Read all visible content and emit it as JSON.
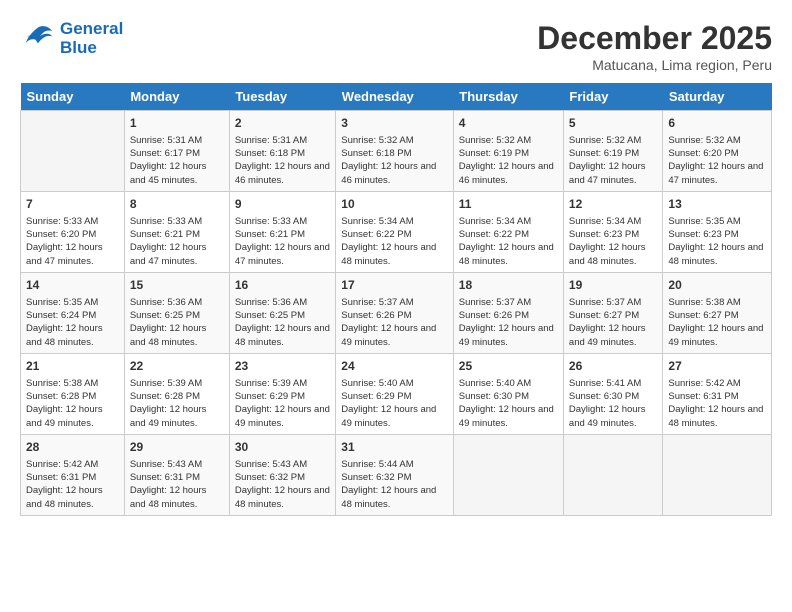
{
  "logo": {
    "line1": "General",
    "line2": "Blue"
  },
  "title": "December 2025",
  "subtitle": "Matucana, Lima region, Peru",
  "days_of_week": [
    "Sunday",
    "Monday",
    "Tuesday",
    "Wednesday",
    "Thursday",
    "Friday",
    "Saturday"
  ],
  "weeks": [
    [
      {
        "day": "",
        "empty": true
      },
      {
        "day": "1",
        "sunrise": "5:31 AM",
        "sunset": "6:17 PM",
        "daylight": "12 hours and 45 minutes."
      },
      {
        "day": "2",
        "sunrise": "5:31 AM",
        "sunset": "6:18 PM",
        "daylight": "12 hours and 46 minutes."
      },
      {
        "day": "3",
        "sunrise": "5:32 AM",
        "sunset": "6:18 PM",
        "daylight": "12 hours and 46 minutes."
      },
      {
        "day": "4",
        "sunrise": "5:32 AM",
        "sunset": "6:19 PM",
        "daylight": "12 hours and 46 minutes."
      },
      {
        "day": "5",
        "sunrise": "5:32 AM",
        "sunset": "6:19 PM",
        "daylight": "12 hours and 47 minutes."
      },
      {
        "day": "6",
        "sunrise": "5:32 AM",
        "sunset": "6:20 PM",
        "daylight": "12 hours and 47 minutes."
      }
    ],
    [
      {
        "day": "7",
        "sunrise": "5:33 AM",
        "sunset": "6:20 PM",
        "daylight": "12 hours and 47 minutes."
      },
      {
        "day": "8",
        "sunrise": "5:33 AM",
        "sunset": "6:21 PM",
        "daylight": "12 hours and 47 minutes."
      },
      {
        "day": "9",
        "sunrise": "5:33 AM",
        "sunset": "6:21 PM",
        "daylight": "12 hours and 47 minutes."
      },
      {
        "day": "10",
        "sunrise": "5:34 AM",
        "sunset": "6:22 PM",
        "daylight": "12 hours and 48 minutes."
      },
      {
        "day": "11",
        "sunrise": "5:34 AM",
        "sunset": "6:22 PM",
        "daylight": "12 hours and 48 minutes."
      },
      {
        "day": "12",
        "sunrise": "5:34 AM",
        "sunset": "6:23 PM",
        "daylight": "12 hours and 48 minutes."
      },
      {
        "day": "13",
        "sunrise": "5:35 AM",
        "sunset": "6:23 PM",
        "daylight": "12 hours and 48 minutes."
      }
    ],
    [
      {
        "day": "14",
        "sunrise": "5:35 AM",
        "sunset": "6:24 PM",
        "daylight": "12 hours and 48 minutes."
      },
      {
        "day": "15",
        "sunrise": "5:36 AM",
        "sunset": "6:25 PM",
        "daylight": "12 hours and 48 minutes."
      },
      {
        "day": "16",
        "sunrise": "5:36 AM",
        "sunset": "6:25 PM",
        "daylight": "12 hours and 48 minutes."
      },
      {
        "day": "17",
        "sunrise": "5:37 AM",
        "sunset": "6:26 PM",
        "daylight": "12 hours and 49 minutes."
      },
      {
        "day": "18",
        "sunrise": "5:37 AM",
        "sunset": "6:26 PM",
        "daylight": "12 hours and 49 minutes."
      },
      {
        "day": "19",
        "sunrise": "5:37 AM",
        "sunset": "6:27 PM",
        "daylight": "12 hours and 49 minutes."
      },
      {
        "day": "20",
        "sunrise": "5:38 AM",
        "sunset": "6:27 PM",
        "daylight": "12 hours and 49 minutes."
      }
    ],
    [
      {
        "day": "21",
        "sunrise": "5:38 AM",
        "sunset": "6:28 PM",
        "daylight": "12 hours and 49 minutes."
      },
      {
        "day": "22",
        "sunrise": "5:39 AM",
        "sunset": "6:28 PM",
        "daylight": "12 hours and 49 minutes."
      },
      {
        "day": "23",
        "sunrise": "5:39 AM",
        "sunset": "6:29 PM",
        "daylight": "12 hours and 49 minutes."
      },
      {
        "day": "24",
        "sunrise": "5:40 AM",
        "sunset": "6:29 PM",
        "daylight": "12 hours and 49 minutes."
      },
      {
        "day": "25",
        "sunrise": "5:40 AM",
        "sunset": "6:30 PM",
        "daylight": "12 hours and 49 minutes."
      },
      {
        "day": "26",
        "sunrise": "5:41 AM",
        "sunset": "6:30 PM",
        "daylight": "12 hours and 49 minutes."
      },
      {
        "day": "27",
        "sunrise": "5:42 AM",
        "sunset": "6:31 PM",
        "daylight": "12 hours and 48 minutes."
      }
    ],
    [
      {
        "day": "28",
        "sunrise": "5:42 AM",
        "sunset": "6:31 PM",
        "daylight": "12 hours and 48 minutes."
      },
      {
        "day": "29",
        "sunrise": "5:43 AM",
        "sunset": "6:31 PM",
        "daylight": "12 hours and 48 minutes."
      },
      {
        "day": "30",
        "sunrise": "5:43 AM",
        "sunset": "6:32 PM",
        "daylight": "12 hours and 48 minutes."
      },
      {
        "day": "31",
        "sunrise": "5:44 AM",
        "sunset": "6:32 PM",
        "daylight": "12 hours and 48 minutes."
      },
      {
        "day": "",
        "empty": true
      },
      {
        "day": "",
        "empty": true
      },
      {
        "day": "",
        "empty": true
      }
    ]
  ]
}
